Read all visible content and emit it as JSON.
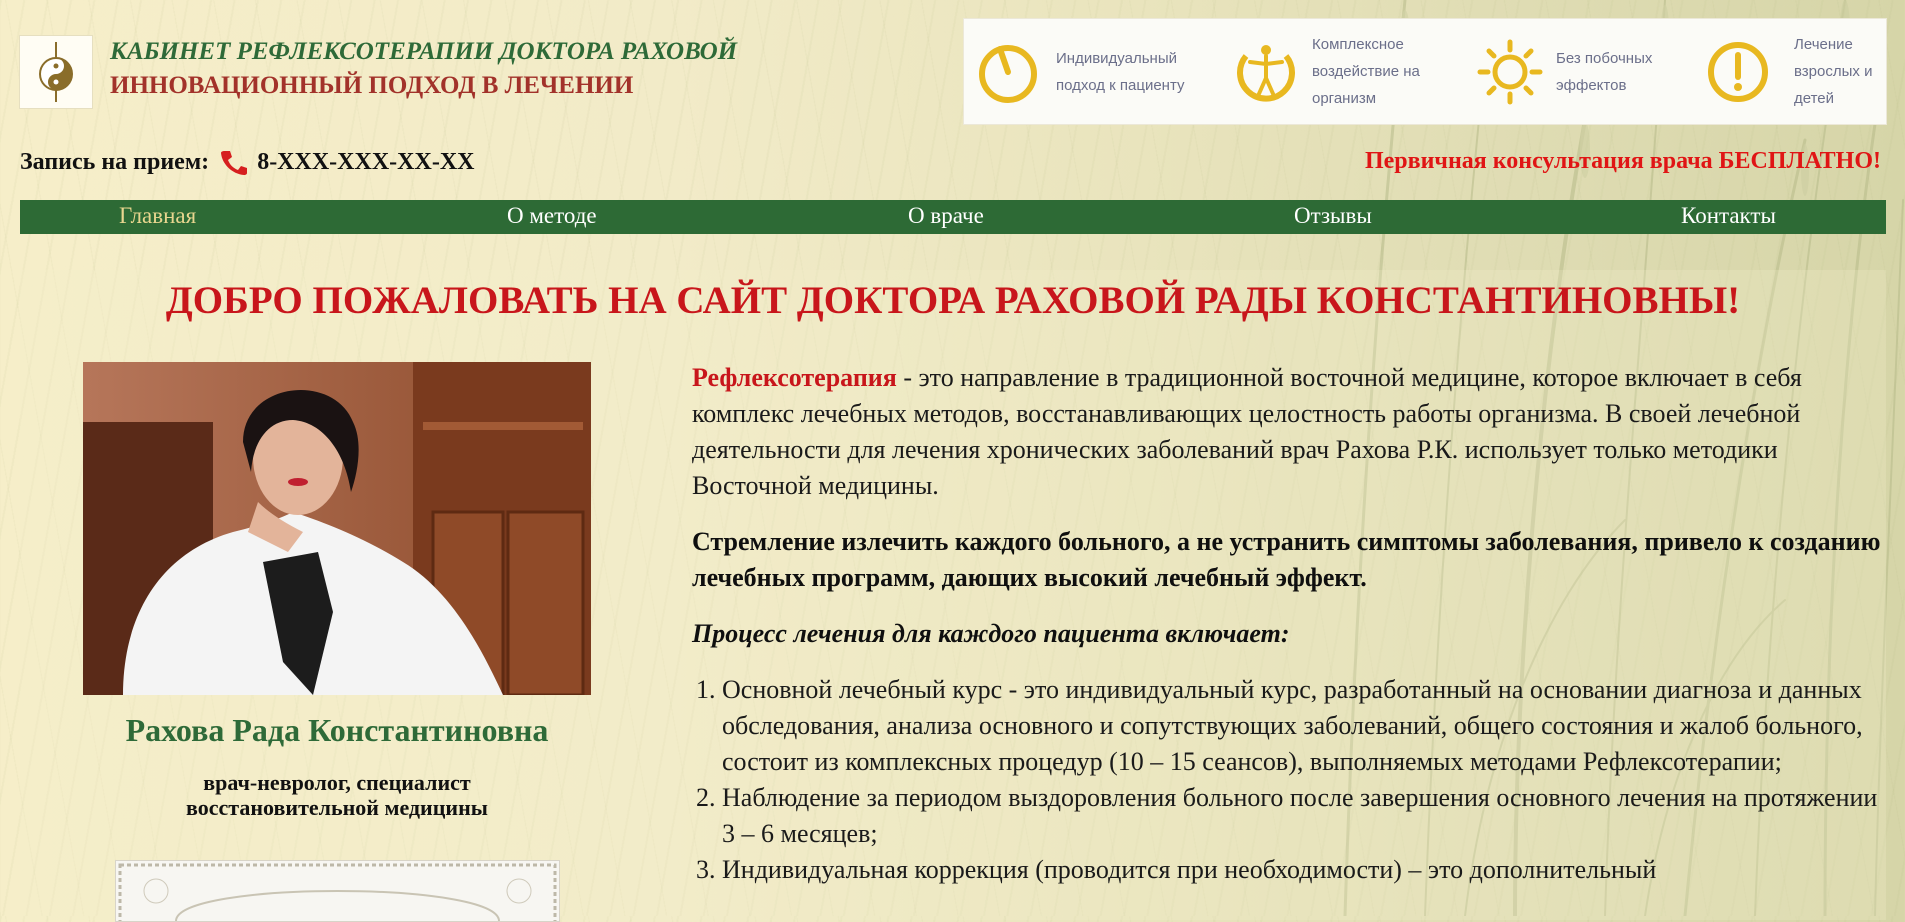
{
  "header": {
    "title_line1": "КАБИНЕТ РЕФЛЕКСОТЕРАПИИ ДОКТОРА РАХОВОЙ",
    "title_line2": "ИННОВАЦИОННЫЙ ПОДХОД В ЛЕЧЕНИИ",
    "logo_icon": "yin-yang-icon"
  },
  "features": [
    {
      "icon": "clock-icon",
      "line1": "Индивидуальный",
      "line2": "подход к пациенту",
      "line3": ""
    },
    {
      "icon": "human-figure-icon",
      "line1": "Комплексное",
      "line2": "воздействие на",
      "line3": "организм"
    },
    {
      "icon": "sun-icon",
      "line1": "Без побочных",
      "line2": "эффектов",
      "line3": ""
    },
    {
      "icon": "exclamation-icon",
      "line1": "Лечение",
      "line2": "взрослых и",
      "line3": "детей"
    }
  ],
  "booking": {
    "label": "Запись на прием:",
    "phone": "8-XXX-XXX-XX-XX",
    "free_consult": "Первичная консультация врача БЕСПЛАТНО!"
  },
  "nav": {
    "items": [
      {
        "label": "Главная",
        "active": true
      },
      {
        "label": "О методе",
        "active": false
      },
      {
        "label": "О враче",
        "active": false
      },
      {
        "label": "Отзывы",
        "active": false
      },
      {
        "label": "Контакты",
        "active": false
      }
    ]
  },
  "main": {
    "welcome": "ДОБРО ПОЖАЛОВАТЬ НА САЙТ ДОКТОРА РАХОВОЙ РАДЫ КОНСТАНТИНОВНЫ!",
    "doctor_name": "Рахова Рада Константиновна",
    "doctor_spec_line1": "врач-невролог, специалист",
    "doctor_spec_line2": "восстановительной медицины",
    "intro_highlight": "Рефлексотерапия",
    "intro_text": " - это направление в традиционной восточной медицине, которое включает в себя комплекс лечебных методов, восстанавливающих целостность работы организма. В своей лечебной деятельности для лечения хронических заболеваний врач Рахова Р.К. использует только методики Восточной медицины.",
    "bold_statement": "Стремление излечить каждого больного, а не устранить симптомы заболевания, привело к созданию лечебных программ, дающих высокий лечебный эффект.",
    "process_heading": "Процесс лечения для каждого пациента включает:",
    "process_items": [
      "Основной лечебный курс - это индивидуальный курс, разработанный на основании диагноза и данных обследования, анализа основного и сопутствующих заболеваний, общего состояния и жалоб больного, состоит из комплексных процедур (10 – 15 сеансов), выполняемых методами Рефлексотерапии;",
      "Наблюдение за периодом выздоровления больного после завершения основного лечения на протяжении 3 – 6 месяцев;",
      "Индивидуальная коррекция (проводится при необходимости) – это дополнительный"
    ]
  },
  "colors": {
    "brand_green": "#2d6a35",
    "accent_red": "#c8161b",
    "nav_active": "#e8d68f",
    "feature_icon": "#e8b820"
  }
}
